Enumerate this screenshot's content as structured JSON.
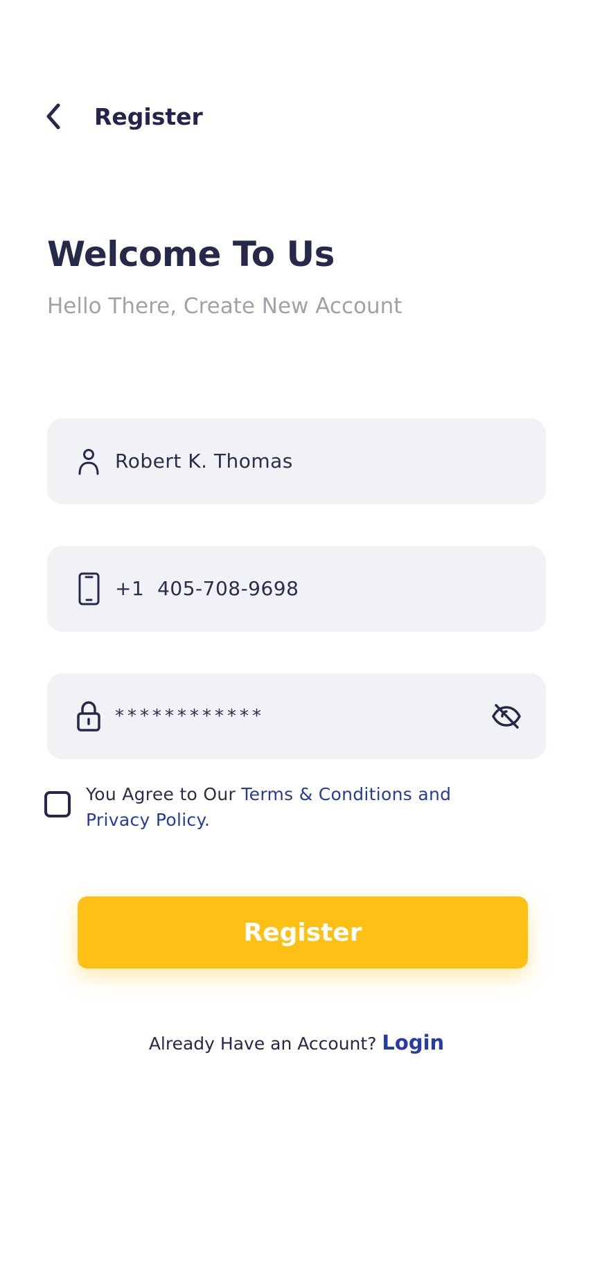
{
  "header": {
    "title": "Register",
    "back_icon": "chevron-left-icon"
  },
  "intro": {
    "heading": "Welcome To Us",
    "subtitle": "Hello There, Create New Account"
  },
  "form": {
    "name": {
      "value": "Robert K. Thomas",
      "icon": "user-icon"
    },
    "phone": {
      "value": "+1  405-708-9698",
      "icon": "smartphone-icon"
    },
    "password": {
      "value": "************",
      "icon": "lock-icon",
      "toggle_icon": "eye-off-icon"
    }
  },
  "agreement": {
    "checked": false,
    "prefix": "You Agree to Our ",
    "link_text": "Terms & Conditions and Privacy Policy."
  },
  "register_button": {
    "label": "Register"
  },
  "login_prompt": {
    "text": "Already Have an Account?",
    "link": "Login"
  },
  "colors": {
    "primary_button": "#fdc014",
    "link": "#243ba0",
    "field_background": "#f1f2f6",
    "heading": "#252a4b",
    "muted_text": "#a0a2aa"
  }
}
